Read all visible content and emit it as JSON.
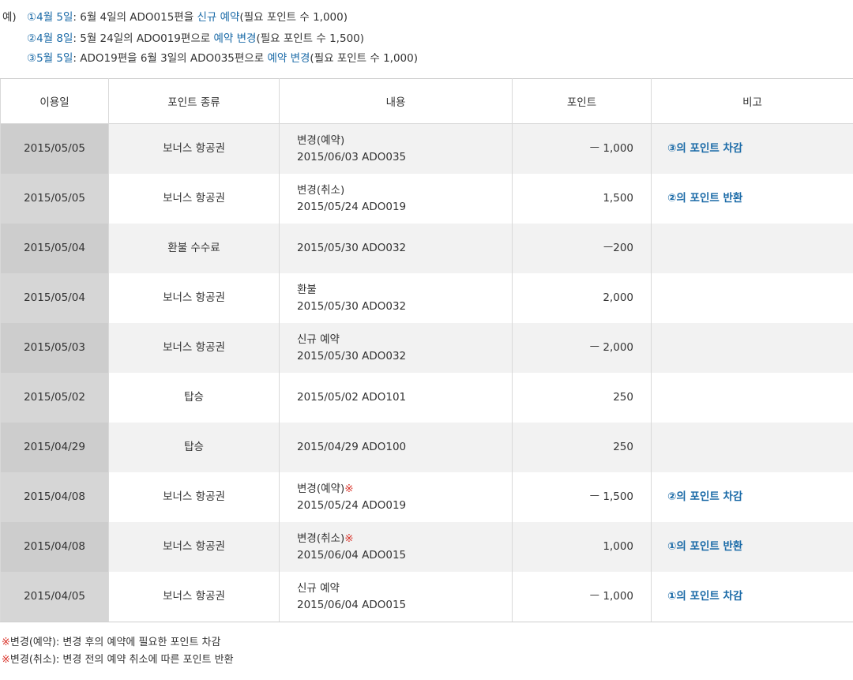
{
  "examples": {
    "prefix": "예)",
    "lines": [
      {
        "date": "①4월 5일",
        "text_a": ": 6월 4일의 ADO015편을 ",
        "action": "신규 예약",
        "text_b": "(필요 포인트 수 1,000)"
      },
      {
        "date": "②4월 8일",
        "text_a": ": 5월 24일의 ADO019편으로 ",
        "action": "예약 변경",
        "text_b": "(필요 포인트 수 1,500)"
      },
      {
        "date": "③5월 5일",
        "text_a": ": ADO19편을 6월 3일의 ADO035편으로 ",
        "action": "예약 변경",
        "text_b": "(필요 포인트 수 1,000)"
      }
    ]
  },
  "table": {
    "headers": [
      "이용일",
      "포인트 종류",
      "내용",
      "포인트",
      "비고"
    ],
    "rows": [
      {
        "date": "2015/05/05",
        "kind": "보너스 항공권",
        "desc1": "변경(예약)",
        "mark": "",
        "desc2": "2015/06/03 ADO035",
        "points": "ㅡ 1,000",
        "note": "③의 포인트 차감"
      },
      {
        "date": "2015/05/05",
        "kind": "보너스 항공권",
        "desc1": "변경(취소)",
        "mark": "",
        "desc2": "2015/05/24 ADO019",
        "points": "1,500",
        "note": "②의 포인트 반환"
      },
      {
        "date": "2015/05/04",
        "kind": "환불 수수료",
        "desc1": "",
        "mark": "",
        "desc2": "2015/05/30 ADO032",
        "points": "ㅡ200",
        "note": ""
      },
      {
        "date": "2015/05/04",
        "kind": "보너스 항공권",
        "desc1": "환불",
        "mark": "",
        "desc2": "2015/05/30 ADO032",
        "points": "2,000",
        "note": ""
      },
      {
        "date": "2015/05/03",
        "kind": "보너스 항공권",
        "desc1": "신규 예약",
        "mark": "",
        "desc2": "2015/05/30 ADO032",
        "points": "ㅡ 2,000",
        "note": ""
      },
      {
        "date": "2015/05/02",
        "kind": "탑승",
        "desc1": "",
        "mark": "",
        "desc2": "2015/05/02 ADO101",
        "points": "250",
        "note": ""
      },
      {
        "date": "2015/04/29",
        "kind": "탑승",
        "desc1": "",
        "mark": "",
        "desc2": "2015/04/29 ADO100",
        "points": "250",
        "note": ""
      },
      {
        "date": "2015/04/08",
        "kind": "보너스 항공권",
        "desc1": "변경(예약)",
        "mark": "※",
        "desc2": "2015/05/24 ADO019",
        "points": "ㅡ 1,500",
        "note": "②의 포인트 차감"
      },
      {
        "date": "2015/04/08",
        "kind": "보너스 항공권",
        "desc1": "변경(취소)",
        "mark": "※",
        "desc2": "2015/06/04 ADO015",
        "points": "1,000",
        "note": "①의 포인트 반환"
      },
      {
        "date": "2015/04/05",
        "kind": "보너스 항공권",
        "desc1": "신규 예약",
        "mark": "",
        "desc2": "2015/06/04 ADO015",
        "points": "ㅡ 1,000",
        "note": "①의 포인트 차감"
      }
    ]
  },
  "footnotes": [
    {
      "mark": "※",
      "text": "변경(예약): 변경 후의 예약에 필요한 포인트 차감"
    },
    {
      "mark": "※",
      "text": "변경(취소): 변경 전의 예약 취소에 따른 포인트 반환"
    }
  ],
  "colors": {
    "accent": "#1a6aa7",
    "mark": "#d9342b",
    "date_column_bg": "#cdcdcd",
    "row_alt_bg": "#f2f2f2"
  }
}
